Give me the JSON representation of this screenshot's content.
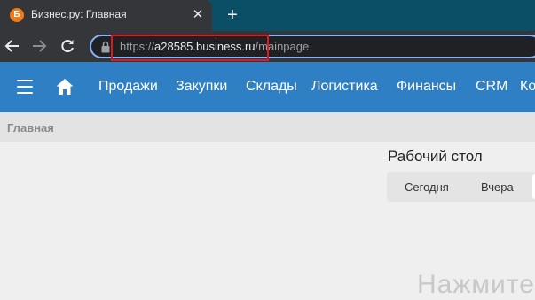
{
  "browser": {
    "tab": {
      "favicon_letter": "Б",
      "title": "Бизнес.ру: Главная",
      "close_label": "✕"
    },
    "new_tab_label": "+",
    "url": {
      "scheme": "https://",
      "host": "a28585.business.ru",
      "path": "/mainpage"
    },
    "highlight_color": "#e0191f"
  },
  "appnav": {
    "items": [
      "Продажи",
      "Закупки",
      "Склады",
      "Логистика",
      "Финансы",
      "CRM",
      "Ко"
    ],
    "background": "#2f7fc4"
  },
  "breadcrumb": "Главная",
  "main": {
    "title": "Рабочий стол",
    "segments": [
      "Сегодня",
      "Вчера"
    ],
    "bottom_text": "Нажмите"
  }
}
